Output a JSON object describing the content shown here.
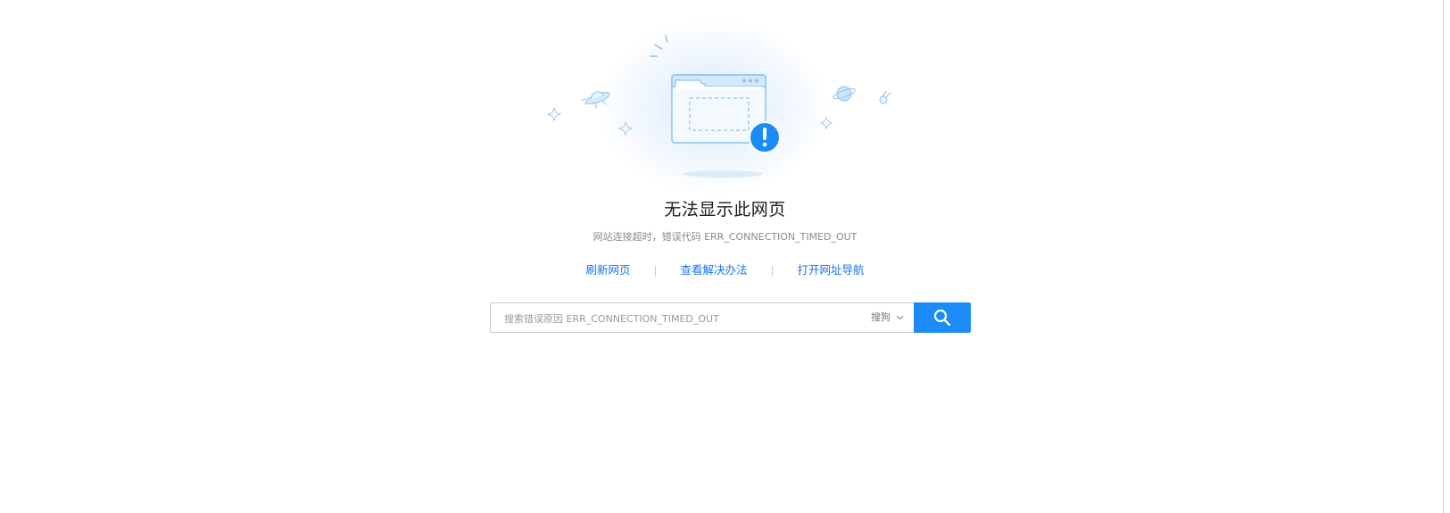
{
  "error": {
    "title": "无法显示此网页",
    "subtitle": "网站连接超时，错误代码 ERR_CONNECTION_TIMED_OUT"
  },
  "actions": {
    "refresh": "刷新网页",
    "solutions": "查看解决办法",
    "navigation": "打开网址导航",
    "separator": "|"
  },
  "search": {
    "placeholder": "搜索错误原因 ERR_CONNECTION_TIMED_OUT",
    "engine": "搜狗"
  },
  "icons": {
    "illustration": "browser-window-error-illustration",
    "alert": "exclamation-icon",
    "search": "search-icon",
    "dropdown": "chevron-down-icon"
  },
  "colors": {
    "accent": "#1a8bf7",
    "link": "#1a73e8",
    "illustration": "#8cc3ef"
  }
}
